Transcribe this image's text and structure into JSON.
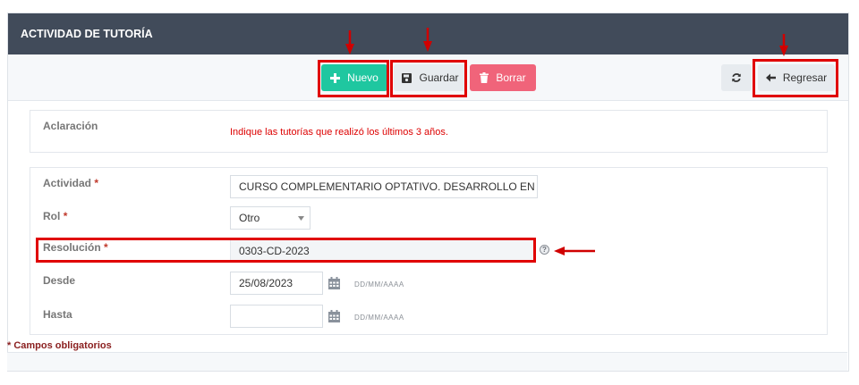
{
  "header": {
    "title": "ACTIVIDAD DE TUTORÍA"
  },
  "toolbar": {
    "nuevo_label": "Nuevo",
    "guardar_label": "Guardar",
    "borrar_label": "Borrar",
    "regresar_label": "Regresar"
  },
  "aclaracion": {
    "label": "Aclaración",
    "text": "Indique las tutorías que realizó los últimos 3 años."
  },
  "form": {
    "actividad": {
      "label": "Actividad",
      "value": "CURSO COMPLEMENTARIO OPTATIVO. DESARROLLO EN F"
    },
    "rol": {
      "label": "Rol",
      "value": "Otro"
    },
    "resolucion": {
      "label": "Resolución",
      "value": "0303-CD-2023"
    },
    "desde": {
      "label": "Desde",
      "value": "25/08/2023",
      "format": "DD/MM/AAAA"
    },
    "hasta": {
      "label": "Hasta",
      "value": "",
      "format": "DD/MM/AAAA"
    },
    "required_mark": "*"
  },
  "footer": {
    "note": "* Campos obligatorios"
  },
  "colors": {
    "header_bg": "#414b5a",
    "nuevo": "#1fc7a0",
    "borrar": "#f0647a",
    "highlight": "#e00000"
  }
}
